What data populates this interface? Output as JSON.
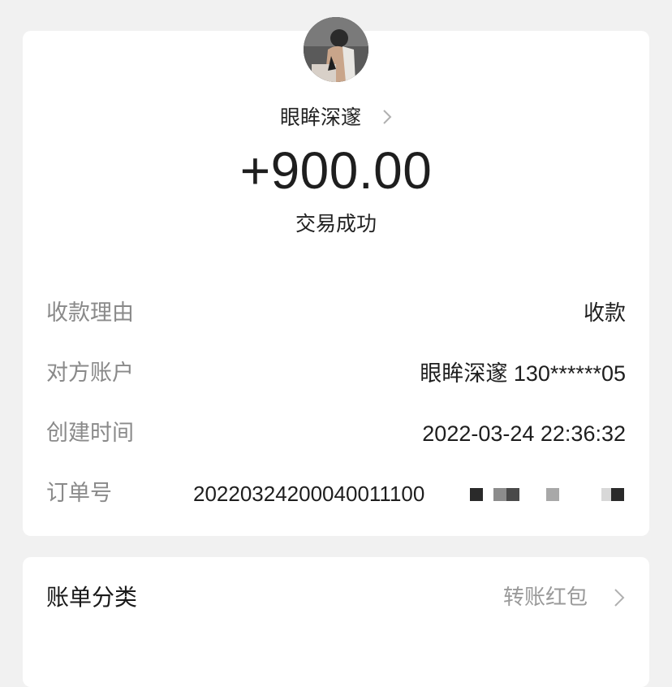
{
  "header": {
    "avatar_icon": "avatar",
    "counterparty_name": "眼眸深邃",
    "amount": "+900.00",
    "status": "交易成功"
  },
  "details": {
    "reason": {
      "label": "收款理由",
      "value": "收款"
    },
    "account": {
      "label": "对方账户",
      "value": "眼眸深邃 130******05"
    },
    "created": {
      "label": "创建时间",
      "value": "2022-03-24 22:36:32"
    },
    "order": {
      "label": "订单号",
      "value": "20220324200040011100"
    }
  },
  "category": {
    "label": "账单分类",
    "value": "转账红包",
    "icon": "chevron-right-icon"
  },
  "colors": {
    "background": "#f1f1f1",
    "card": "#ffffff",
    "label_gray": "#8a8a8a",
    "text_dark": "#1e1e1e"
  }
}
